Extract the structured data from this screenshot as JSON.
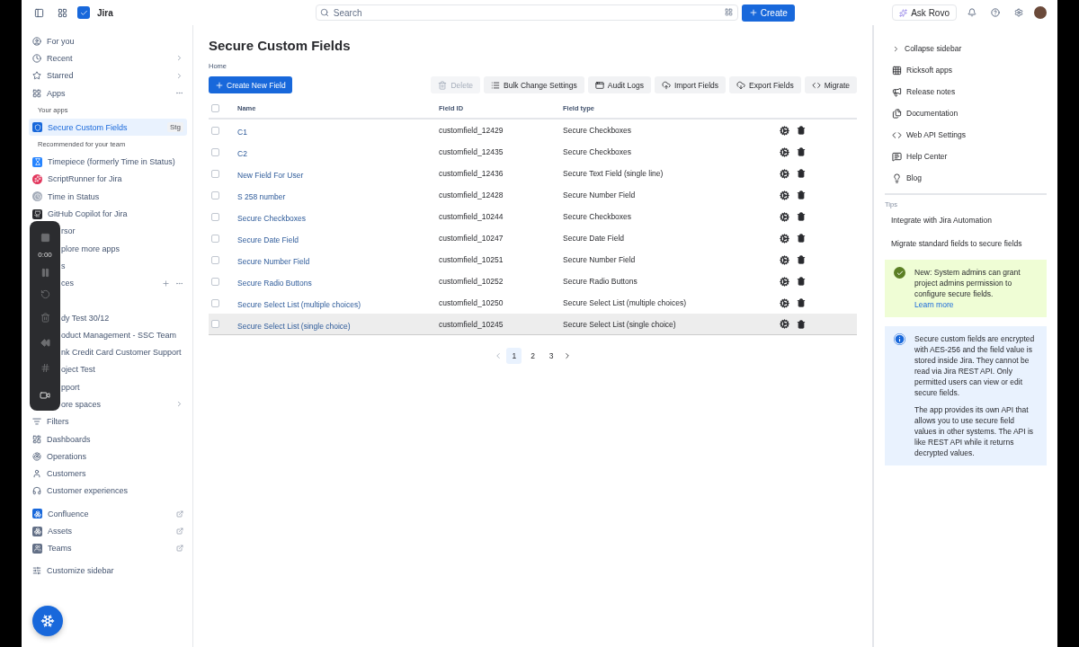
{
  "topbar": {
    "product": "Jira",
    "search": {
      "placeholder": "Search"
    },
    "create": "Create",
    "ask": "Ask Rovo"
  },
  "sidebar": {
    "items": [
      {
        "kind": "nav",
        "label": "For you",
        "selected": false
      },
      {
        "kind": "nav",
        "label": "Recent",
        "selected": false
      },
      {
        "kind": "nav",
        "label": "Starred",
        "selected": false
      },
      {
        "kind": "nav",
        "label": "Apps",
        "selected": false
      },
      {
        "kind": "heading",
        "label": "Your apps"
      },
      {
        "kind": "app",
        "label": "Secure Custom Fields",
        "badge": "Stg",
        "selected": true
      },
      {
        "kind": "heading",
        "label": "Recommended for your team"
      },
      {
        "kind": "app",
        "label": "Timepiece (formerly Time in Status)",
        "selected": false
      },
      {
        "kind": "app",
        "label": "ScriptRunner for Jira",
        "selected": false
      },
      {
        "kind": "app",
        "label": "Time in Status",
        "selected": false
      },
      {
        "kind": "app",
        "label": "GitHub Copilot for Jira",
        "selected": false
      },
      {
        "kind": "covered",
        "label": "rsor",
        "selected": false
      },
      {
        "kind": "covered",
        "label": "plore more apps",
        "selected": false
      },
      {
        "kind": "covered",
        "label": "s",
        "selected": false
      },
      {
        "kind": "covered",
        "label": "ces",
        "selected": false
      },
      {
        "kind": "covered",
        "label": "dy Test 30/12",
        "selected": false
      },
      {
        "kind": "covered",
        "label": "oduct Management - SSC Team",
        "selected": false
      },
      {
        "kind": "covered",
        "label": "nk Credit Card Customer Support",
        "selected": false
      },
      {
        "kind": "covered",
        "label": "oject Test",
        "selected": false
      },
      {
        "kind": "covered",
        "label": "pport",
        "selected": false
      },
      {
        "kind": "covered",
        "label": "ore spaces",
        "selected": false
      },
      {
        "kind": "nav",
        "label": "Filters",
        "selected": false
      },
      {
        "kind": "nav",
        "label": "Dashboards",
        "selected": false
      },
      {
        "kind": "nav",
        "label": "Operations",
        "selected": false
      },
      {
        "kind": "nav",
        "label": "Customers",
        "selected": false
      },
      {
        "kind": "nav",
        "label": "Customer experiences",
        "selected": false
      },
      {
        "kind": "nav",
        "label": "Confluence",
        "selected": false
      },
      {
        "kind": "nav",
        "label": "Assets",
        "selected": false
      },
      {
        "kind": "nav",
        "label": "Teams",
        "selected": false
      },
      {
        "kind": "nav",
        "label": "Customize sidebar",
        "selected": false
      }
    ]
  },
  "recorder": {
    "time": "0:00"
  },
  "page": {
    "title": "Secure Custom Fields",
    "breadcrumb": "Home",
    "primary": "Create New Field",
    "actions": [
      {
        "label": "Delete",
        "disabled": true
      },
      {
        "label": "Bulk Change Settings",
        "disabled": false
      },
      {
        "label": "Audit Logs",
        "disabled": false
      },
      {
        "label": "Import Fields",
        "disabled": false
      },
      {
        "label": "Export Fields",
        "disabled": false
      },
      {
        "label": "Migrate",
        "disabled": false
      }
    ]
  },
  "table": {
    "columns": [
      "Name",
      "Field ID",
      "Field type"
    ],
    "all_checked": false,
    "rows": [
      {
        "name": "C1",
        "id": "customfield_12429",
        "type": "Secure Checkboxes",
        "checked": false,
        "selected": false
      },
      {
        "name": "C2",
        "id": "customfield_12435",
        "type": "Secure Checkboxes",
        "checked": false,
        "selected": false
      },
      {
        "name": "New Field For User",
        "id": "customfield_12436",
        "type": "Secure Text Field (single line)",
        "checked": false,
        "selected": false
      },
      {
        "name": "S 258 number",
        "id": "customfield_12428",
        "type": "Secure Number Field",
        "checked": false,
        "selected": false
      },
      {
        "name": "Secure Checkboxes",
        "id": "customfield_10244",
        "type": "Secure Checkboxes",
        "checked": false,
        "selected": false
      },
      {
        "name": "Secure Date Field",
        "id": "customfield_10247",
        "type": "Secure Date Field",
        "checked": false,
        "selected": false
      },
      {
        "name": "Secure Number Field",
        "id": "customfield_10251",
        "type": "Secure Number Field",
        "checked": false,
        "selected": false
      },
      {
        "name": "Secure Radio Buttons",
        "id": "customfield_10252",
        "type": "Secure Radio Buttons",
        "checked": false,
        "selected": false
      },
      {
        "name": "Secure Select List (multiple choices)",
        "id": "customfield_10250",
        "type": "Secure Select List (multiple choices)",
        "checked": false,
        "selected": false
      },
      {
        "name": "Secure Select List (single choice)",
        "id": "customfield_10245",
        "type": "Secure Select List (single choice)",
        "checked": false,
        "selected": true
      }
    ]
  },
  "pagination": [
    {
      "label": "1",
      "selected": true
    },
    {
      "label": "2",
      "selected": false
    },
    {
      "label": "3",
      "selected": false
    }
  ],
  "panel": {
    "collapse": "Collapse sidebar",
    "links": [
      "Ricksoft apps",
      "Release notes",
      "Documentation",
      "Web API Settings",
      "Help Center",
      "Blog"
    ],
    "tips_heading": "Tips",
    "tips": [
      "Integrate with Jira Automation",
      "Migrate standard fields to secure fields"
    ],
    "notices": [
      {
        "kind": "success",
        "paragraphs": [
          "New: System admins can grant project admins permission to configure secure fields."
        ],
        "link": "Learn more"
      },
      {
        "kind": "info",
        "paragraphs": [
          "Secure custom fields are encrypted with AES-256 and the field value is stored inside Jira. They cannot be read via Jira REST API. Only permitted users can view or edit secure fields.",
          "The app provides its own API that allows you to use secure field values in other systems. The API is like REST API while it returns decrypted values."
        ]
      }
    ]
  }
}
